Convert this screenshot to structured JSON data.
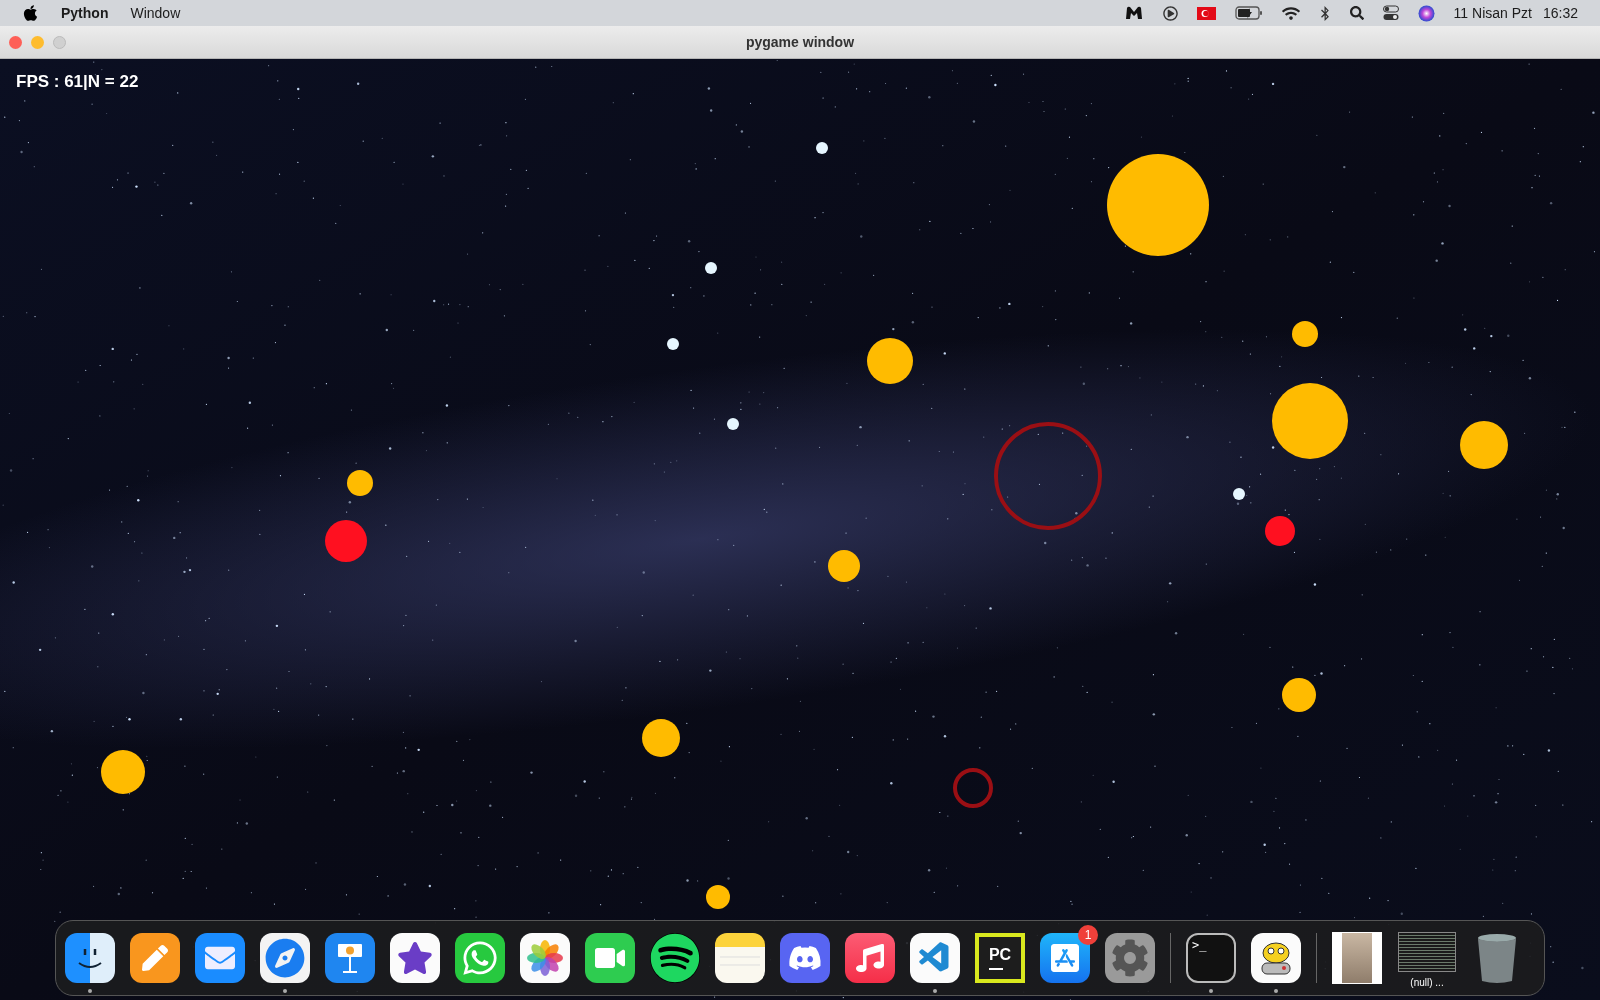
{
  "menu_bar": {
    "app_name": "Python",
    "menus": [
      "Window"
    ],
    "date": "11 Nisan Pzt",
    "time": "16:32"
  },
  "window": {
    "title": "pygame window",
    "hud": "FPS : 61|N = 22"
  },
  "dock": {
    "items": [
      {
        "kind": "finder",
        "running": true
      },
      {
        "kind": "pages",
        "running": false
      },
      {
        "kind": "mail",
        "running": false
      },
      {
        "kind": "safari",
        "running": true
      },
      {
        "kind": "keynote",
        "running": false
      },
      {
        "kind": "imovie",
        "running": false
      },
      {
        "kind": "whatsapp",
        "running": false
      },
      {
        "kind": "photos",
        "running": false
      },
      {
        "kind": "facetime",
        "running": false
      },
      {
        "kind": "spotify",
        "running": false
      },
      {
        "kind": "notes",
        "running": false
      },
      {
        "kind": "discord",
        "running": false
      },
      {
        "kind": "music",
        "running": false
      },
      {
        "kind": "vscode",
        "running": true
      },
      {
        "kind": "pycharm",
        "running": false,
        "icon_text": "PC"
      },
      {
        "kind": "appstore",
        "running": false,
        "badge": "1"
      },
      {
        "kind": "settings",
        "running": false
      },
      {
        "kind": "separator"
      },
      {
        "kind": "terminal",
        "running": true,
        "icon_text": ">_"
      },
      {
        "kind": "game",
        "running": true
      },
      {
        "kind": "separator"
      },
      {
        "kind": "photo-window"
      },
      {
        "kind": "text-window",
        "label": "(null) ..."
      },
      {
        "kind": "trash"
      }
    ]
  }
}
